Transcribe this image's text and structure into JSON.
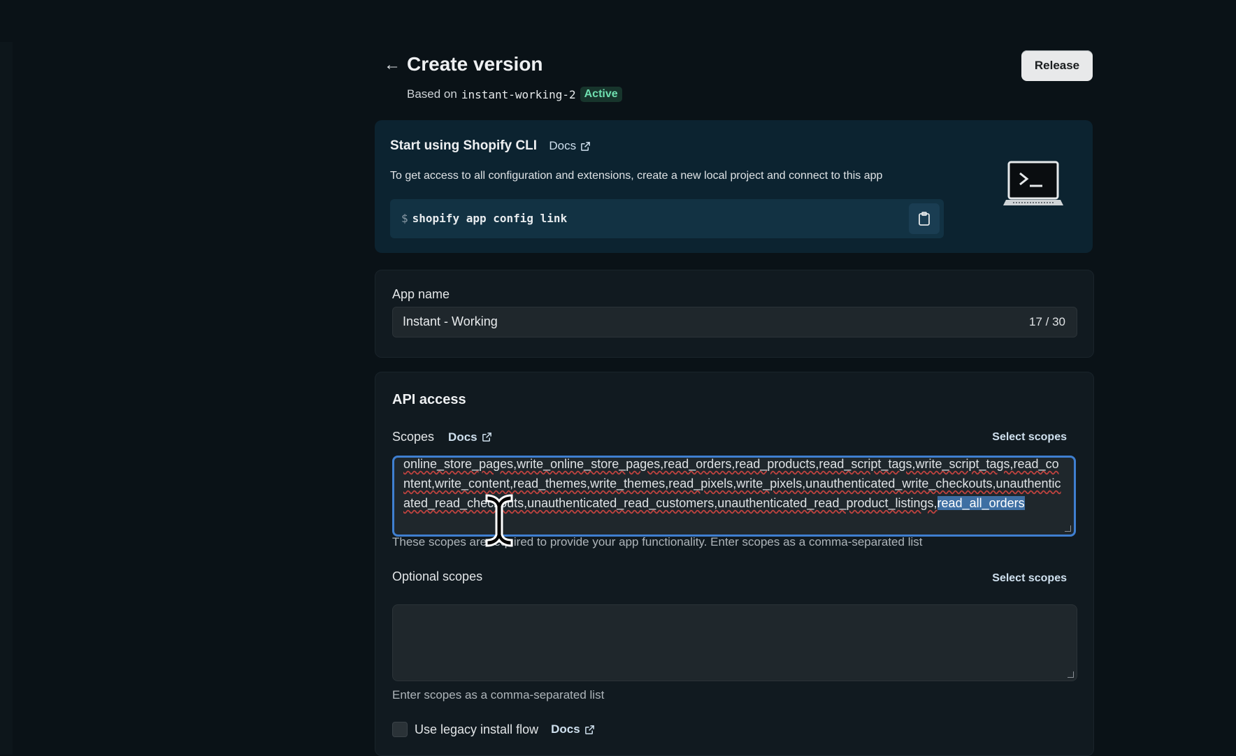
{
  "header": {
    "title": "Create version",
    "based_on_label": "Based on",
    "version_name": "instant-working-2",
    "status_badge": "Active",
    "release_label": "Release"
  },
  "cli": {
    "title": "Start using Shopify CLI",
    "docs_label": "Docs",
    "description": "To get access to all configuration and extensions, create a new local project and connect to this app",
    "prompt": "$",
    "command": "shopify app config link"
  },
  "app_name": {
    "label": "App name",
    "value": "Instant - Working",
    "char_count": "17 / 30"
  },
  "api_access": {
    "title": "API access",
    "scopes": {
      "label": "Scopes",
      "docs_label": "Docs",
      "select_label": "Select scopes",
      "text_part1": "online_store_pages,write_online_store_pages,read_orders,read_products,read_script_tags,write_script_tags,read_content,write_content,read_themes,write_themes,read_pixels,write_pixels,unauthenticated_write_checkouts,unauthenticated_read_checkouts,unauthenticated_read_customers,unauthenticated_read_product_listings,",
      "text_selected": "read_all_orders",
      "help": "These scopes are required to provide your app functionality. Enter scopes as a comma-separated list"
    },
    "optional_scopes": {
      "label": "Optional scopes",
      "select_label": "Select scopes",
      "value": "",
      "help": "Enter scopes as a comma-separated list"
    },
    "legacy": {
      "label": "Use legacy install flow",
      "docs_label": "Docs",
      "checked": false
    }
  }
}
